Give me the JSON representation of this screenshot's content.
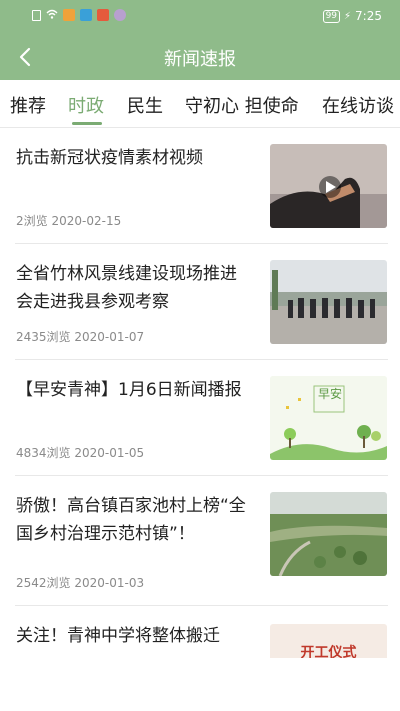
{
  "status_bar": {
    "battery": "99",
    "time": "7:25",
    "icons": [
      "sim-icon",
      "wifi-icon",
      "message-icon",
      "app-icon",
      "video-icon",
      "vpn-icon"
    ]
  },
  "header": {
    "back_icon": "chevron-left-icon",
    "title": "新闻速报"
  },
  "tabs": [
    {
      "label": "推荐",
      "active": false
    },
    {
      "label": "时政",
      "active": true
    },
    {
      "label": "民生",
      "active": false
    },
    {
      "label": "守初心 担使命",
      "active": false
    },
    {
      "label": "在线访谈",
      "active": false
    }
  ],
  "news": [
    {
      "title": "抗击新冠状疫情素材视频",
      "views": "2浏览",
      "date": "2020-02-15",
      "has_video": true
    },
    {
      "title": "全省竹林风景线建设现场推进会走进我县参观考察",
      "views": "2435浏览",
      "date": "2020-01-07",
      "has_video": false
    },
    {
      "title": "【早安青神】1月6日新闻播报",
      "views": "4834浏览",
      "date": "2020-01-05",
      "has_video": false,
      "thumb_text": "早安"
    },
    {
      "title": "骄傲！高台镇百家池村上榜“全国乡村治理示范村镇”！",
      "views": "2542浏览",
      "date": "2020-01-03",
      "has_video": false
    },
    {
      "title": "关注！青神中学将整体搬迁",
      "views": "",
      "date": "",
      "has_video": false,
      "thumb_text": "开工仪式"
    }
  ],
  "colors": {
    "brand": "#8fbb8a",
    "active_tab": "#7bab73",
    "meta": "#8a8a8a"
  }
}
